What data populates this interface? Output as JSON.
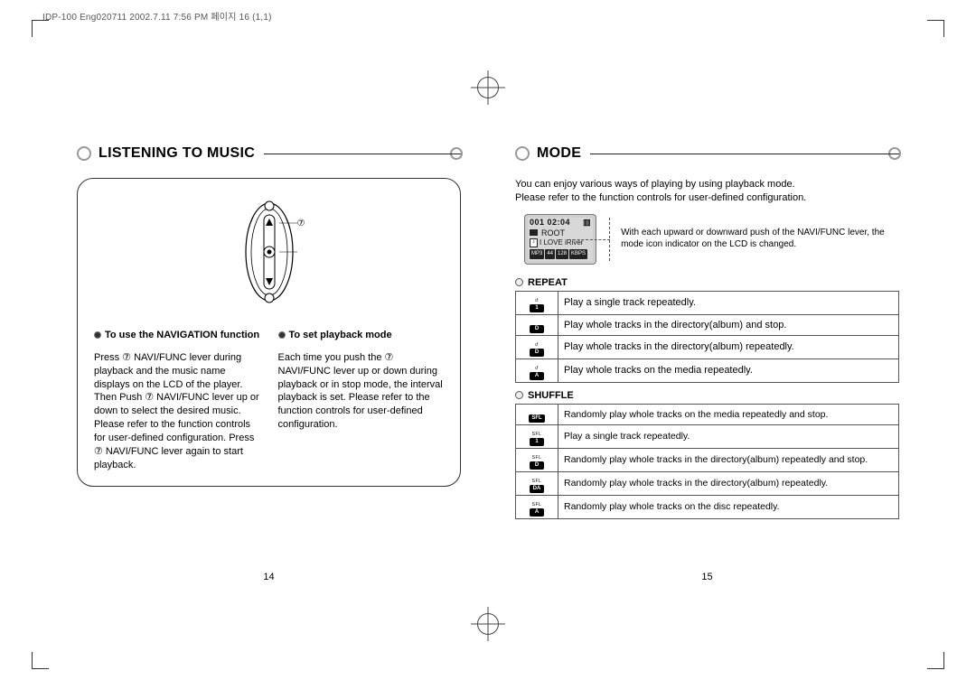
{
  "meta": {
    "header": "IDP-100 Eng020711  2002.7.11 7:56 PM  페이지 16 (1,1)"
  },
  "left": {
    "title": "LISTENING TO MUSIC",
    "callout": "⑦",
    "col1": {
      "head": "To use the NAVIGATION function",
      "body": "Press ⑦ NAVI/FUNC lever during playback and the music name displays on the LCD of the player. Then Push ⑦ NAVI/FUNC lever up or down to select the desired music. Please refer to the function controls for user-defined configuration. Press ⑦ NAVI/FUNC lever again to start playback."
    },
    "col2": {
      "head": "To set playback mode",
      "body": "Each time you push the ⑦ NAVI/FUNC lever up or down during playback or in stop mode, the interval playback is set. Please refer to the function controls for user-defined configuration."
    },
    "pagenum": "14"
  },
  "right": {
    "title": "MODE",
    "intro1": "You can enjoy various ways of playing by using playback mode.",
    "intro2": "Please refer to the function controls  for user-defined configuration.",
    "lcd": {
      "time": "001 02:04",
      "root": "ROOT",
      "track": "I LOVE iRiver",
      "tag1": "MP3",
      "tag2": "44",
      "tag3": "128",
      "tag4": "KBPS"
    },
    "lcd_note": "With each upward or downward push of the NAVI/FUNC lever, the mode icon indicator on the LCD is changed.",
    "repeat_label": "REPEAT",
    "repeat": [
      {
        "icon_top": "↺",
        "icon_bot": "1",
        "text": "Play a single track repeatedly."
      },
      {
        "icon_top": "",
        "icon_bot": "D",
        "text": "Play whole tracks in the directory(album) and stop."
      },
      {
        "icon_top": "↺",
        "icon_bot": "D",
        "text": "Play whole tracks in the directory(album) repeatedly."
      },
      {
        "icon_top": "↺",
        "icon_bot": "A",
        "text": "Play whole tracks on the media repeatedly."
      }
    ],
    "shuffle_label": "SHUFFLE",
    "shuffle": [
      {
        "icon_top": "",
        "icon_bot": "SFL",
        "text": "Randomly play whole tracks on the media repeatedly and stop."
      },
      {
        "icon_top": "SFL",
        "icon_bot": "1",
        "text": "Play a single track repeatedly."
      },
      {
        "icon_top": "SFL",
        "icon_bot": "D",
        "text": "Randomly play whole tracks in the directory(album) repeatedly and stop."
      },
      {
        "icon_top": "SFL",
        "icon_bot": "DA",
        "text": "Randomly play whole tracks in the directory(album) repeatedly."
      },
      {
        "icon_top": "SFL",
        "icon_bot": "A",
        "text": "Randomly play whole tracks on the disc repeatedly."
      }
    ],
    "pagenum": "15"
  }
}
